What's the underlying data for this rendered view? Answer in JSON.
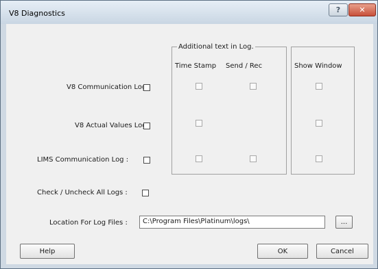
{
  "window": {
    "title": "V8 Diagnostics",
    "help_glyph": "?",
    "close_glyph": "✕"
  },
  "group": {
    "legend": "Additional text in Log.",
    "col_time_stamp": "Time Stamp",
    "col_send_rec": "Send / Rec"
  },
  "show_window_header": "Show Window",
  "rows": [
    {
      "label": "V8 Communication Log :"
    },
    {
      "label": "V8 Actual Values Log :"
    },
    {
      "label": "LIMS Communication Log :"
    }
  ],
  "check_all_label": "Check / Uncheck All Logs :",
  "location": {
    "label": "Location For Log Files :",
    "value": "C:\\Program Files\\Platinum\\logs\\",
    "browse_label": "..."
  },
  "buttons": {
    "help": "Help",
    "ok": "OK",
    "cancel": "Cancel"
  }
}
